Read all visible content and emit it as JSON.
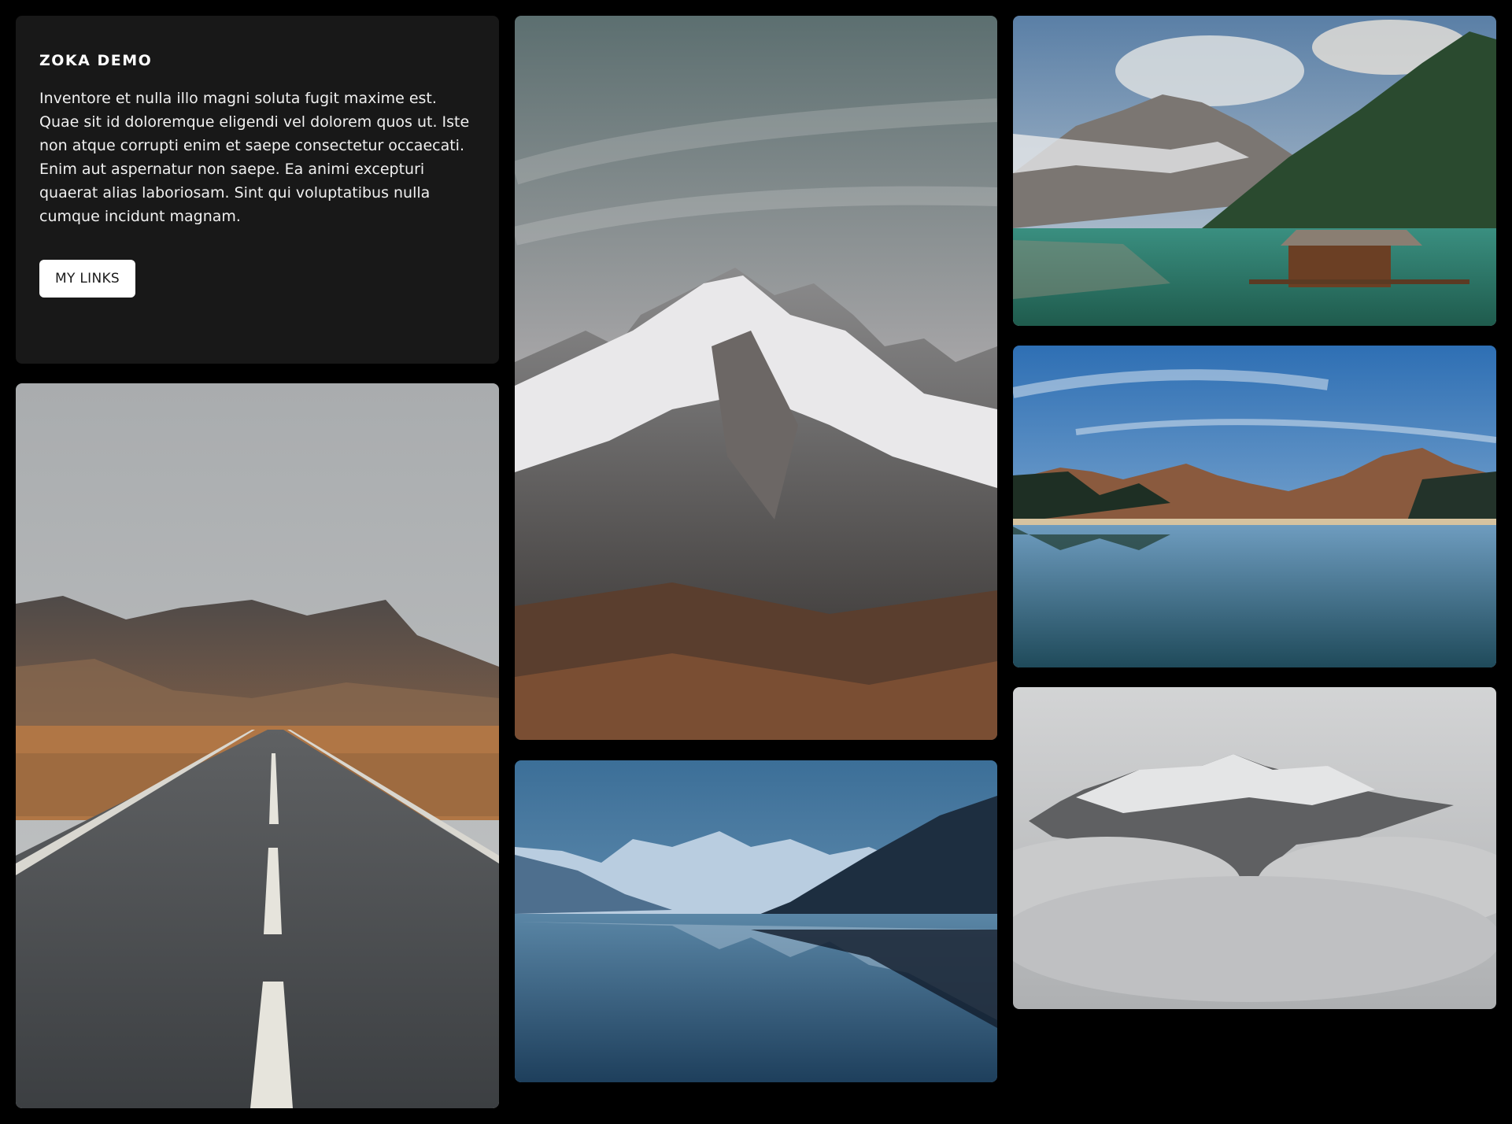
{
  "intro": {
    "title": "ZOKA DEMO",
    "body": "Inventore et nulla illo magni soluta fugit maxime est. Quae sit id doloremque eligendi vel dolorem quos ut. Iste non atque corrupti enim et saepe consectetur occaecati. Enim aut aspernatur non saepe. Ea animi excepturi quaerat alias laboriosam. Sint qui voluptatibus nulla cumque incidunt magnam.",
    "button_label": "MY LINKS"
  },
  "colors": {
    "background": "#000000",
    "card": "#181818",
    "button_bg": "#ffffff",
    "button_text": "#1a1a1a"
  }
}
